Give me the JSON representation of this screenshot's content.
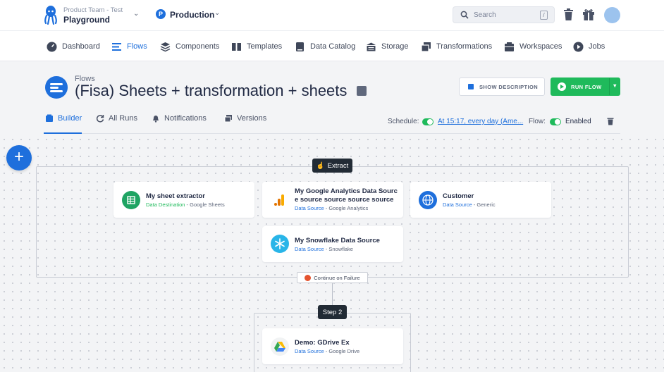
{
  "project": {
    "subtitle": "Product Team - Test",
    "name": "Playground"
  },
  "branch": {
    "initial": "P",
    "name": "Production"
  },
  "search": {
    "placeholder": "Search",
    "shortcut": "/"
  },
  "nav": [
    {
      "label": "Dashboard",
      "icon": "dashboard-icon"
    },
    {
      "label": "Flows",
      "icon": "flows-icon",
      "active": true
    },
    {
      "label": "Components",
      "icon": "components-icon"
    },
    {
      "label": "Templates",
      "icon": "templates-icon"
    },
    {
      "label": "Data Catalog",
      "icon": "data-catalog-icon"
    },
    {
      "label": "Storage",
      "icon": "storage-icon"
    },
    {
      "label": "Transformations",
      "icon": "transformations-icon"
    },
    {
      "label": "Workspaces",
      "icon": "workspaces-icon"
    },
    {
      "label": "Jobs",
      "icon": "jobs-icon"
    }
  ],
  "header": {
    "breadcrumb": "Flows",
    "title": "(Fisa) Sheets + transformation + sheets",
    "show_description": "SHOW DESCRIPTION",
    "run_flow": "RUN FLOW"
  },
  "tabs": [
    {
      "label": "Builder",
      "active": true
    },
    {
      "label": "All Runs"
    },
    {
      "label": "Notifications"
    },
    {
      "label": "Versions"
    }
  ],
  "schedule": {
    "label": "Schedule:",
    "value": "At 15:17, every day (Ame...",
    "flow_label": "Flow:",
    "flow_status": "Enabled"
  },
  "canvas": {
    "phase1": "Extract",
    "continue_on_failure": "Continue on Failure",
    "phase2": "Step 2",
    "cards": [
      {
        "name": "My sheet extractor",
        "type": "Data Destination",
        "component": "Google Sheets"
      },
      {
        "name_line1": "My Google Analytics Data Sourc",
        "name_line2": "e source source source source",
        "type": "Data Source",
        "component": "Google Analytics"
      },
      {
        "name": "Customer",
        "type": "Data Source",
        "component": "Generic"
      },
      {
        "name": "My Snowflake Data Source",
        "type": "Data Source",
        "component": "Snowflake"
      },
      {
        "name": "Demo: GDrive Ex",
        "type": "Data Source",
        "component": "Google Drive"
      }
    ],
    "separator": " - "
  },
  "colors": {
    "primary": "#1e6fdc",
    "success": "#1fba5b",
    "dark": "#222b35"
  }
}
